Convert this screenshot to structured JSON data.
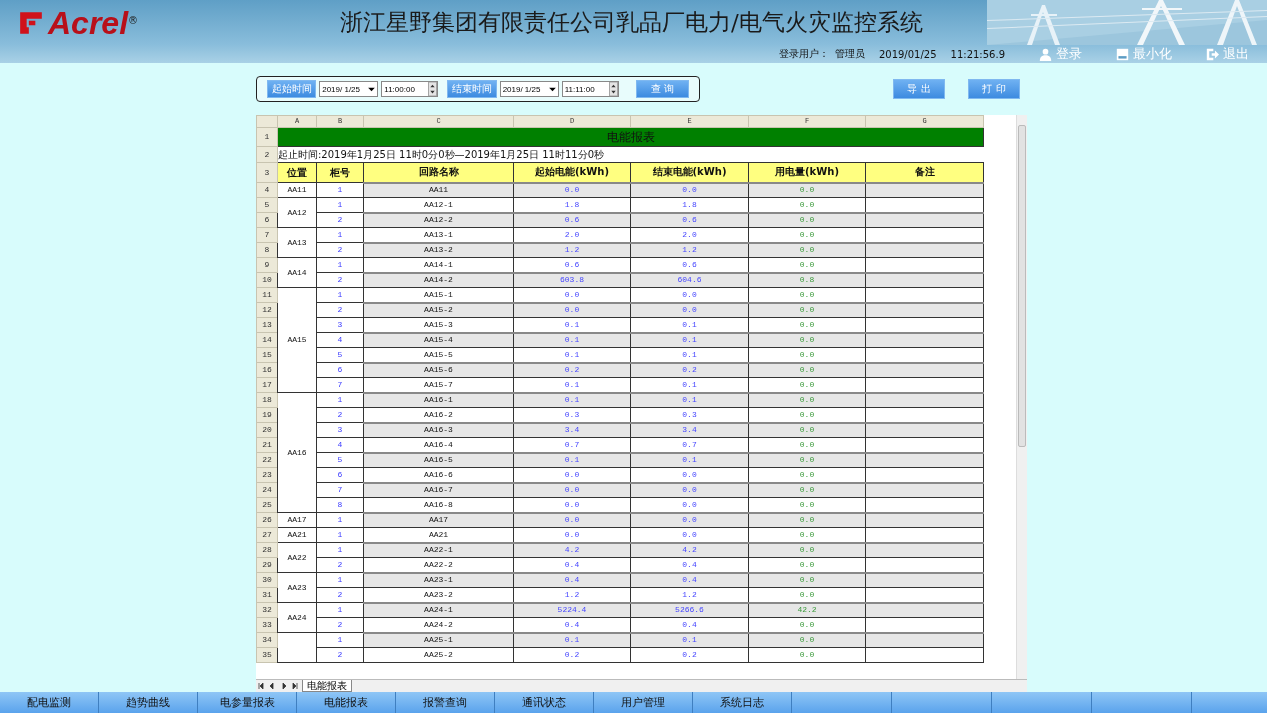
{
  "header": {
    "logo": "Acrel",
    "logo_mark": "®",
    "title": "浙江星野集团有限责任公司乳品厂电力/电气火灾监控系统",
    "user_label": "登录用户：",
    "user": "管理员",
    "date": "2019/01/25",
    "time": "11:21:56.9",
    "buttons": [
      {
        "label": "登录",
        "kind": "login"
      },
      {
        "label": "最小化",
        "kind": "minimize"
      },
      {
        "label": "退出",
        "kind": "exit"
      }
    ]
  },
  "query": {
    "start_button": "起始时间",
    "start_date": "2019/ 1/25",
    "start_time": "11:00:00",
    "end_button": "结束时间",
    "end_date": "2019/ 1/25",
    "end_time": "11:11:00",
    "search_button": "查 询"
  },
  "actions": [
    "导 出",
    "打 印"
  ],
  "sheet": {
    "column_letters": [
      "A",
      "B",
      "C",
      "D",
      "E",
      "F",
      "G"
    ],
    "row_numbers": [
      "1",
      "2",
      "3",
      "4",
      "5",
      "6",
      "7",
      "8",
      "9",
      "10",
      "11",
      "12",
      "13",
      "14",
      "15",
      "16",
      "17",
      "18",
      "19",
      "20",
      "21",
      "22",
      "23",
      "24",
      "25",
      "26",
      "27",
      "28",
      "29",
      "30",
      "31",
      "32",
      "33",
      "34",
      "35"
    ],
    "title": "电能报表",
    "period": "起止时间:2019年1月25日 11时0分0秒—2019年1月25日 11时11分0秒",
    "headers": [
      "位置",
      "柜号",
      "回路名称",
      "起始电能(kWh)",
      "结束电能(kWh)",
      "用电量(kWh)",
      "备注"
    ],
    "groups": [
      {
        "location": "AA11",
        "circuits": [
          {
            "cabinet": "1",
            "name": "AA11",
            "start": "0.0",
            "end": "0.0",
            "usage": "0.0"
          }
        ]
      },
      {
        "location": "AA12",
        "circuits": [
          {
            "cabinet": "1",
            "name": "AA12-1",
            "start": "1.8",
            "end": "1.8",
            "usage": "0.0"
          },
          {
            "cabinet": "2",
            "name": "AA12-2",
            "start": "0.6",
            "end": "0.6",
            "usage": "0.0"
          }
        ]
      },
      {
        "location": "AA13",
        "circuits": [
          {
            "cabinet": "1",
            "name": "AA13-1",
            "start": "2.0",
            "end": "2.0",
            "usage": "0.0"
          },
          {
            "cabinet": "2",
            "name": "AA13-2",
            "start": "1.2",
            "end": "1.2",
            "usage": "0.0"
          }
        ]
      },
      {
        "location": "AA14",
        "circuits": [
          {
            "cabinet": "1",
            "name": "AA14-1",
            "start": "0.6",
            "end": "0.6",
            "usage": "0.0"
          },
          {
            "cabinet": "2",
            "name": "AA14-2",
            "start": "603.8",
            "end": "604.6",
            "usage": "0.8"
          }
        ]
      },
      {
        "location": "AA15",
        "circuits": [
          {
            "cabinet": "1",
            "name": "AA15-1",
            "start": "0.0",
            "end": "0.0",
            "usage": "0.0"
          },
          {
            "cabinet": "2",
            "name": "AA15-2",
            "start": "0.0",
            "end": "0.0",
            "usage": "0.0"
          },
          {
            "cabinet": "3",
            "name": "AA15-3",
            "start": "0.1",
            "end": "0.1",
            "usage": "0.0"
          },
          {
            "cabinet": "4",
            "name": "AA15-4",
            "start": "0.1",
            "end": "0.1",
            "usage": "0.0"
          },
          {
            "cabinet": "5",
            "name": "AA15-5",
            "start": "0.1",
            "end": "0.1",
            "usage": "0.0"
          },
          {
            "cabinet": "6",
            "name": "AA15-6",
            "start": "0.2",
            "end": "0.2",
            "usage": "0.0"
          },
          {
            "cabinet": "7",
            "name": "AA15-7",
            "start": "0.1",
            "end": "0.1",
            "usage": "0.0"
          }
        ]
      },
      {
        "location": "AA16",
        "circuits": [
          {
            "cabinet": "1",
            "name": "AA16-1",
            "start": "0.1",
            "end": "0.1",
            "usage": "0.0"
          },
          {
            "cabinet": "2",
            "name": "AA16-2",
            "start": "0.3",
            "end": "0.3",
            "usage": "0.0"
          },
          {
            "cabinet": "3",
            "name": "AA16-3",
            "start": "3.4",
            "end": "3.4",
            "usage": "0.0"
          },
          {
            "cabinet": "4",
            "name": "AA16-4",
            "start": "0.7",
            "end": "0.7",
            "usage": "0.0"
          },
          {
            "cabinet": "5",
            "name": "AA16-5",
            "start": "0.1",
            "end": "0.1",
            "usage": "0.0"
          },
          {
            "cabinet": "6",
            "name": "AA16-6",
            "start": "0.0",
            "end": "0.0",
            "usage": "0.0"
          },
          {
            "cabinet": "7",
            "name": "AA16-7",
            "start": "0.0",
            "end": "0.0",
            "usage": "0.0"
          },
          {
            "cabinet": "8",
            "name": "AA16-8",
            "start": "0.0",
            "end": "0.0",
            "usage": "0.0"
          }
        ]
      },
      {
        "location": "AA17",
        "circuits": [
          {
            "cabinet": "1",
            "name": "AA17",
            "start": "0.0",
            "end": "0.0",
            "usage": "0.0"
          }
        ]
      },
      {
        "location": "AA21",
        "circuits": [
          {
            "cabinet": "1",
            "name": "AA21",
            "start": "0.0",
            "end": "0.0",
            "usage": "0.0"
          }
        ]
      },
      {
        "location": "AA22",
        "circuits": [
          {
            "cabinet": "1",
            "name": "AA22-1",
            "start": "4.2",
            "end": "4.2",
            "usage": "0.0"
          },
          {
            "cabinet": "2",
            "name": "AA22-2",
            "start": "0.4",
            "end": "0.4",
            "usage": "0.0"
          }
        ]
      },
      {
        "location": "AA23",
        "circuits": [
          {
            "cabinet": "1",
            "name": "AA23-1",
            "start": "0.4",
            "end": "0.4",
            "usage": "0.0"
          },
          {
            "cabinet": "2",
            "name": "AA23-2",
            "start": "1.2",
            "end": "1.2",
            "usage": "0.0"
          }
        ]
      },
      {
        "location": "AA24",
        "circuits": [
          {
            "cabinet": "1",
            "name": "AA24-1",
            "start": "5224.4",
            "end": "5266.6",
            "usage": "42.2"
          },
          {
            "cabinet": "2",
            "name": "AA24-2",
            "start": "0.4",
            "end": "0.4",
            "usage": "0.0"
          }
        ]
      },
      {
        "circuits": [
          {
            "cabinet": "1",
            "name": "AA25-1",
            "start": "0.1",
            "end": "0.1",
            "usage": "0.0"
          },
          {
            "cabinet": "2",
            "name": "AA25-2",
            "start": "0.2",
            "end": "0.2",
            "usage": "0.0"
          }
        ]
      }
    ],
    "sheet_tab": "电能报表"
  },
  "nav": [
    "配电监测",
    "趋势曲线",
    "电参量报表",
    "电能报表",
    "报警查询",
    "通讯状态",
    "用户管理",
    "系统日志"
  ]
}
